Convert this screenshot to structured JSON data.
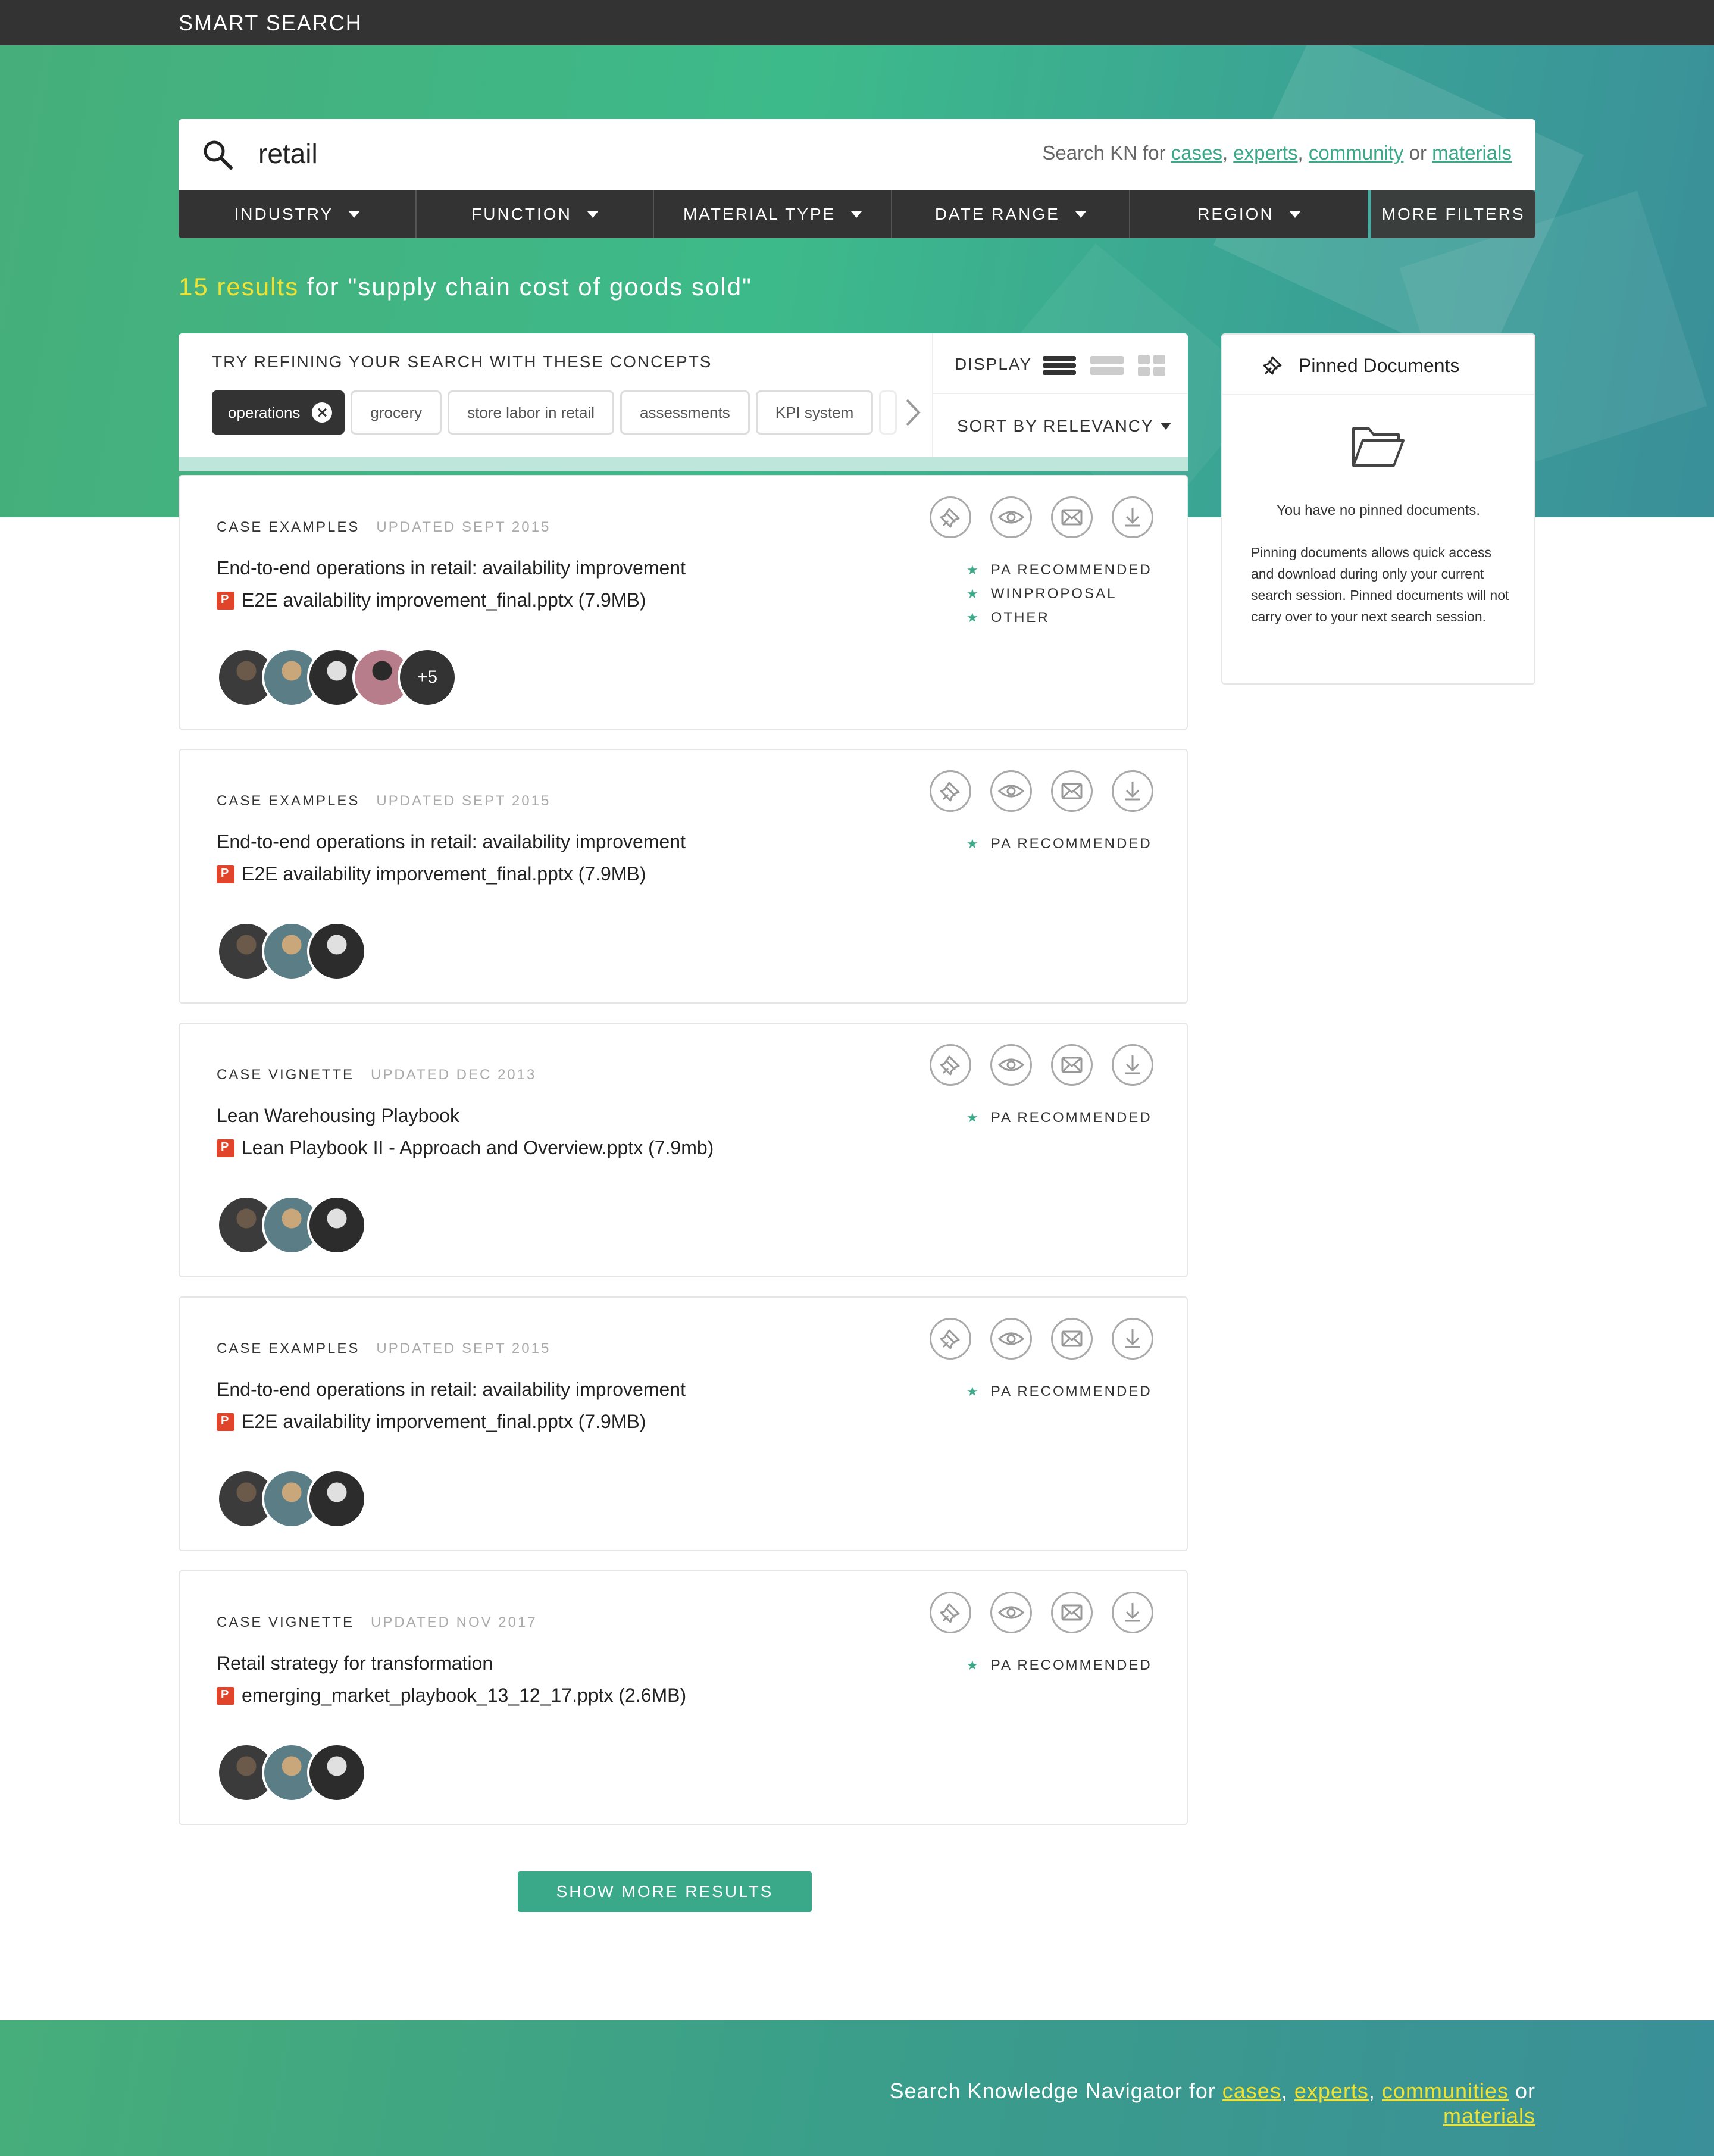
{
  "topbar": {
    "brand": "SMART SEARCH"
  },
  "search": {
    "query": "retail",
    "hint_prefix": "Search KN for ",
    "hint_links": [
      "cases",
      "experts",
      "community",
      "materials"
    ],
    "hint_sep1": ", ",
    "hint_sep2": ", ",
    "hint_or": " or "
  },
  "filters": [
    {
      "label": "INDUSTRY"
    },
    {
      "label": "FUNCTION"
    },
    {
      "label": "MATERIAL TYPE"
    },
    {
      "label": "DATE RANGE"
    },
    {
      "label": "REGION"
    }
  ],
  "more_filters": "MORE FILTERS",
  "results": {
    "count_text": "15 results",
    "for_text": " for \"supply chain cost of goods sold\""
  },
  "refine": {
    "title": "TRY REFINING YOUR SEARCH WITH THESE CONCEPTS",
    "chips": [
      "operations",
      "grocery",
      "store labor in retail",
      "assessments",
      "KPI system"
    ],
    "display_label": "DISPLAY",
    "sort_label": "SORT BY RELEVANCY"
  },
  "cards": [
    {
      "type": "CASE EXAMPLES",
      "date": "UPDATED SEPT 2015",
      "title": "End-to-end operations in retail: availability improvement",
      "file": "E2E availability improvement_final.pptx (7.9MB)",
      "tags": [
        "PA RECOMMENDED",
        "WINPROPOSAL",
        "OTHER"
      ],
      "more_count": "+5"
    },
    {
      "type": "CASE EXAMPLES",
      "date": "UPDATED SEPT 2015",
      "title": "End-to-end operations in retail: availability improvement",
      "file": "E2E availability imporvement_final.pptx (7.9MB)",
      "tags": [
        "PA RECOMMENDED"
      ]
    },
    {
      "type": "CASE VIGNETTE",
      "date": "UPDATED DEC 2013",
      "title": "Lean Warehousing Playbook",
      "file": "Lean Playbook II - Approach and Overview.pptx (7.9mb)",
      "tags": [
        "PA RECOMMENDED"
      ]
    },
    {
      "type": "CASE EXAMPLES",
      "date": "UPDATED SEPT 2015",
      "title": "End-to-end operations in retail: availability improvement",
      "file": "E2E availability imporvement_final.pptx (7.9MB)",
      "tags": [
        "PA RECOMMENDED"
      ]
    },
    {
      "type": "CASE VIGNETTE",
      "date": "UPDATED NOV 2017",
      "title": "Retail strategy for transformation",
      "file": "emerging_market_playbook_13_12_17.pptx (2.6MB)",
      "tags": [
        "PA RECOMMENDED"
      ]
    }
  ],
  "show_more": "SHOW MORE RESULTS",
  "pinned": {
    "title": "Pinned Documents",
    "empty": "You have no pinned documents.",
    "desc": "Pinning documents allows quick access and download during only your current search session. Pinned documents will not carry over to your next search session."
  },
  "footer": {
    "prefix": "Search Knowledge Navigator for ",
    "links": [
      "cases",
      "experts",
      "communities",
      "materials"
    ],
    "sep1": ", ",
    "sep2": ", ",
    "or": " or "
  },
  "colors": {
    "accent": "#3aa98a",
    "highlight": "#f0e030",
    "dark": "#333333"
  }
}
